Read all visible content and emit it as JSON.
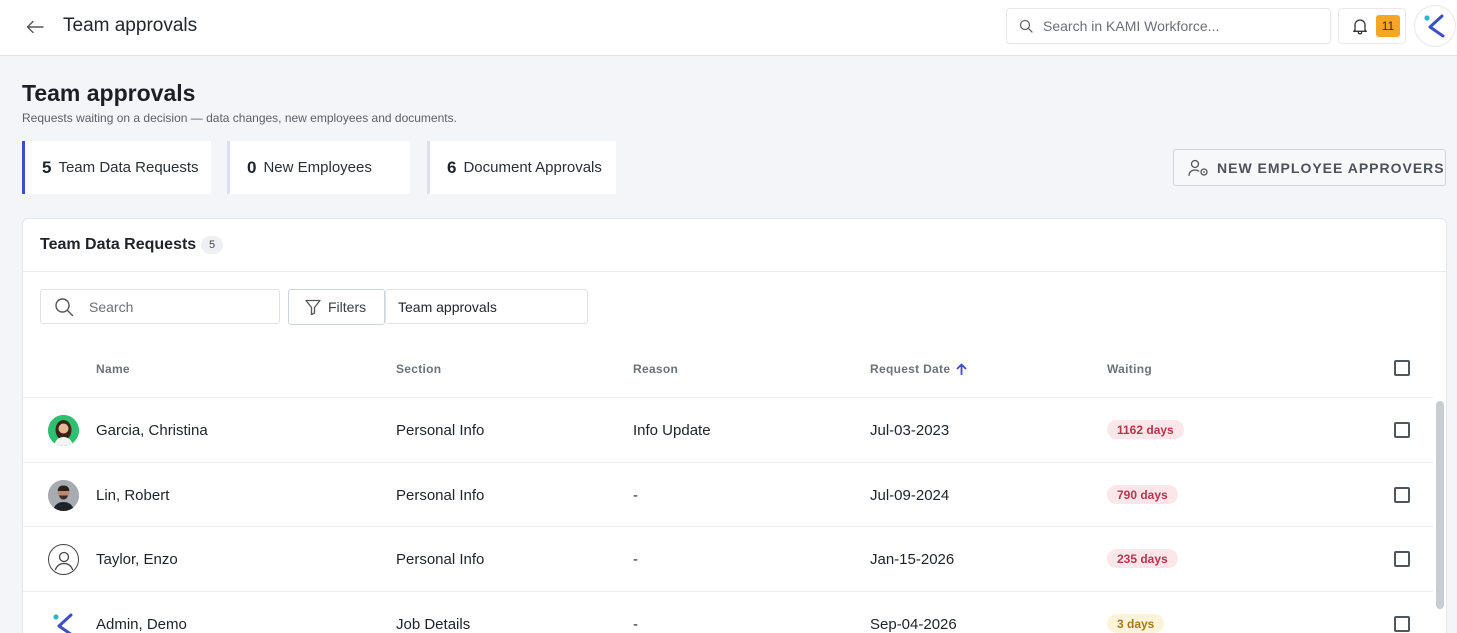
{
  "topbar": {
    "title": "Team approvals",
    "search_placeholder": "Search in KAMI Workforce...",
    "notification_count": "11"
  },
  "page": {
    "title": "Team approvals",
    "subtitle": "Requests waiting on a decision — data changes, new employees and documents."
  },
  "stats": [
    {
      "count": "5",
      "label": "Team Data Requests",
      "active": true
    },
    {
      "count": "0",
      "label": "New Employees",
      "active": false
    },
    {
      "count": "6",
      "label": "Document Approvals",
      "active": false
    }
  ],
  "approvers_button": "NEW EMPLOYEE APPROVERS",
  "panel": {
    "title": "Team Data Requests",
    "count": "5",
    "search_placeholder": "Search",
    "filters_label": "Filters",
    "view_value": "Team approvals"
  },
  "table": {
    "headers": {
      "name": "Name",
      "section": "Section",
      "reason": "Reason",
      "request_date": "Request Date",
      "waiting": "Waiting"
    },
    "sort": {
      "column": "request_date",
      "direction": "ascending"
    },
    "rows": [
      {
        "name": "Garcia, Christina",
        "section": "Personal Info",
        "reason": "Info Update",
        "request_date": "Jul-03-2023",
        "waiting": "1162 days",
        "waiting_level": "red",
        "avatar": "photo-woman"
      },
      {
        "name": "Lin, Robert",
        "section": "Personal Info",
        "reason": "-",
        "request_date": "Jul-09-2024",
        "waiting": "790 days",
        "waiting_level": "red",
        "avatar": "photo-man"
      },
      {
        "name": "Taylor, Enzo",
        "section": "Personal Info",
        "reason": "-",
        "request_date": "Jan-15-2026",
        "waiting": "235 days",
        "waiting_level": "red",
        "avatar": "default-user-icon"
      },
      {
        "name": "Admin, Demo",
        "section": "Job Details",
        "reason": "-",
        "request_date": "Sep-04-2026",
        "waiting": "3 days",
        "waiting_level": "amber",
        "avatar": "kami-logo"
      }
    ]
  },
  "colors": {
    "accent": "#3b50c8",
    "badge": "#f6a623",
    "waiting_red_bg": "#fbe6ea",
    "waiting_red_text": "#b8344c",
    "waiting_amber_bg": "#fdf3d9",
    "waiting_amber_text": "#a77a12"
  }
}
